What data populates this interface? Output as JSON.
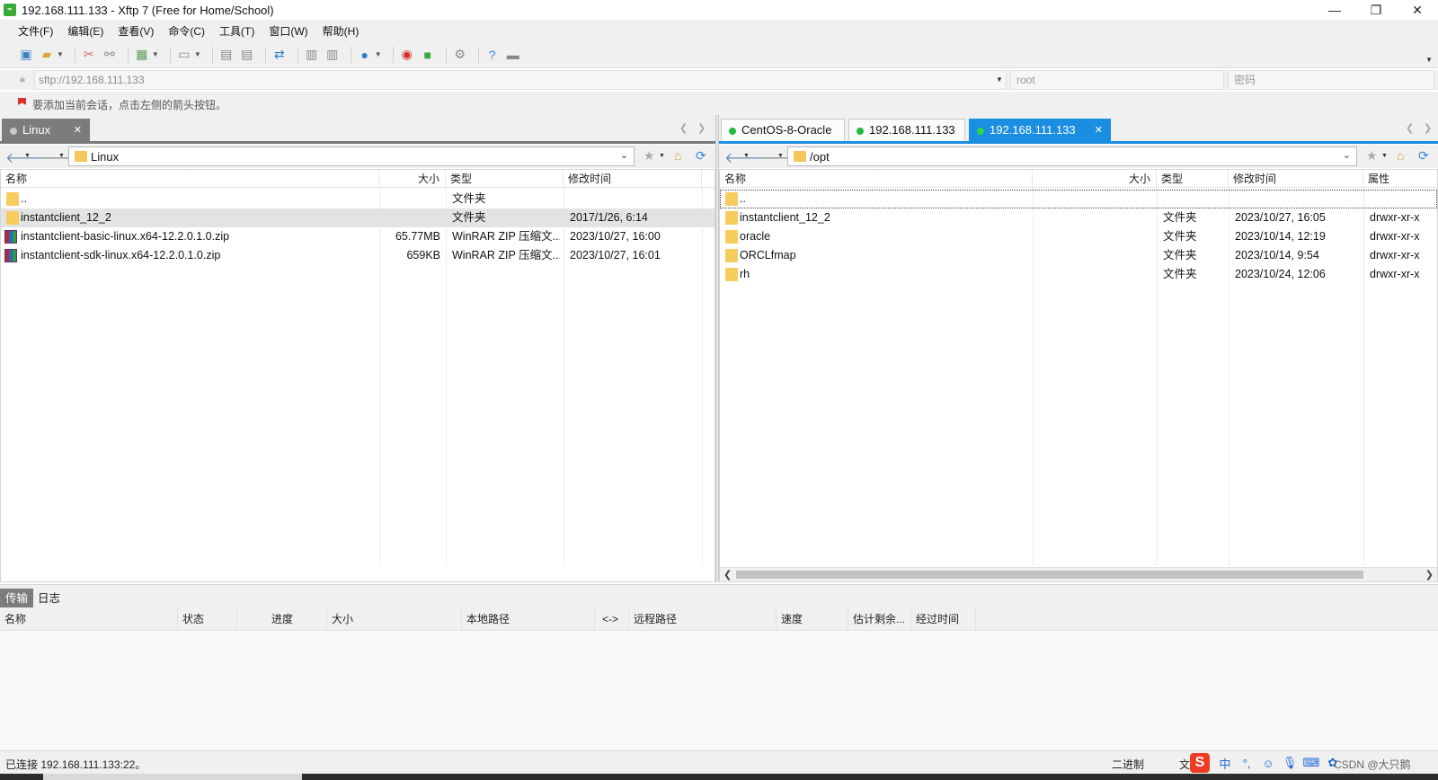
{
  "window": {
    "title": "192.168.111.133 - Xftp 7 (Free for Home/School)",
    "app_icon": "xftp-icon",
    "minimize": "—",
    "maximize": "❐",
    "close": "✕"
  },
  "menu": [
    "文件(F)",
    "编辑(E)",
    "查看(V)",
    "命令(C)",
    "工具(T)",
    "窗口(W)",
    "帮助(H)"
  ],
  "address": {
    "url": "sftp://192.168.111.133",
    "user": "root",
    "password_placeholder": "密码"
  },
  "hint": "要添加当前会话，点击左侧的箭头按钮。",
  "left": {
    "tab": "Linux",
    "path": "Linux",
    "columns": [
      "名称",
      "大小",
      "类型",
      "修改时间"
    ],
    "rows": [
      {
        "name": "..",
        "size": "",
        "type": "文件夹",
        "modified": "",
        "icon": "folder-icon"
      },
      {
        "name": "instantclient_12_2",
        "size": "",
        "type": "文件夹",
        "modified": "2017/1/26, 6:14",
        "icon": "folder-icon"
      },
      {
        "name": "instantclient-basic-linux.x64-12.2.0.1.0.zip",
        "size": "65.77MB",
        "type": "WinRAR ZIP 压缩文...",
        "modified": "2023/10/27, 16:00",
        "icon": "zip-icon"
      },
      {
        "name": "instantclient-sdk-linux.x64-12.2.0.1.0.zip",
        "size": "659KB",
        "type": "WinRAR ZIP 压缩文...",
        "modified": "2023/10/27, 16:01",
        "icon": "zip-icon"
      }
    ]
  },
  "right": {
    "tabs": [
      "CentOS-8-Oracle",
      "192.168.111.133",
      "192.168.111.133"
    ],
    "path": "/opt",
    "columns": [
      "名称",
      "大小",
      "类型",
      "修改时间",
      "属性"
    ],
    "rows": [
      {
        "name": "..",
        "type": "",
        "modified": "",
        "attr": ""
      },
      {
        "name": "instantclient_12_2",
        "type": "文件夹",
        "modified": "2023/10/27, 16:05",
        "attr": "drwxr-xr-x"
      },
      {
        "name": "oracle",
        "type": "文件夹",
        "modified": "2023/10/14, 12:19",
        "attr": "drwxr-xr-x"
      },
      {
        "name": "ORCLfmap",
        "type": "文件夹",
        "modified": "2023/10/14, 9:54",
        "attr": "drwxr-xr-x"
      },
      {
        "name": "rh",
        "type": "文件夹",
        "modified": "2023/10/24, 12:06",
        "attr": "drwxr-xr-x"
      }
    ]
  },
  "bottom": {
    "tabs": [
      "传输",
      "日志"
    ],
    "columns": [
      "名称",
      "状态",
      "进度",
      "大小",
      "本地路径",
      "<->",
      "远程路径",
      "速度",
      "估计剩余...",
      "经过时间"
    ]
  },
  "status": {
    "text": "已连接 192.168.111.133:22。",
    "mode": "二进制",
    "doc": "文",
    "ime_logo": "S",
    "ime_lang": "中",
    "watermark": "CSDN @大只鹅"
  },
  "colors": {
    "accent": "#1a8ee0",
    "selection": "#e3e3e3",
    "folder": "#f6cd5d",
    "online_dot": "#1fbb3d"
  }
}
